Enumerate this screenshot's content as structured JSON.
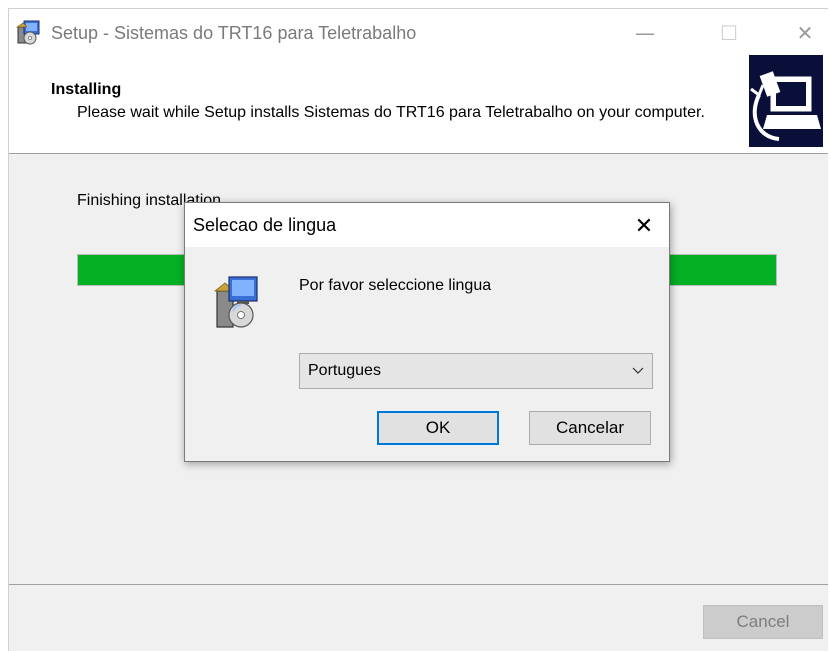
{
  "window": {
    "title": "Setup - Sistemas do TRT16 para Teletrabalho",
    "minimize_glyph": "—",
    "maximize_glyph": "☐",
    "close_glyph": "✕",
    "icon": "setup-app-icon"
  },
  "header": {
    "title": "Installing",
    "subtitle": "Please wait while Setup installs Sistemas do TRT16 para Teletrabalho on your computer.",
    "icon": "computer-install-icon"
  },
  "body": {
    "status": "Finishing installation...",
    "progress_fraction": 1.0,
    "progress_color": "#06b025"
  },
  "footer": {
    "cancel_label": "Cancel"
  },
  "dialog": {
    "title": "Selecao de lingua",
    "close_glyph": "✕",
    "prompt": "Por favor seleccione lingua",
    "icon": "setup-app-icon",
    "language_selected": "Portugues",
    "ok_label": "OK",
    "cancel_label": "Cancelar",
    "focus_color": "#0078d7"
  }
}
